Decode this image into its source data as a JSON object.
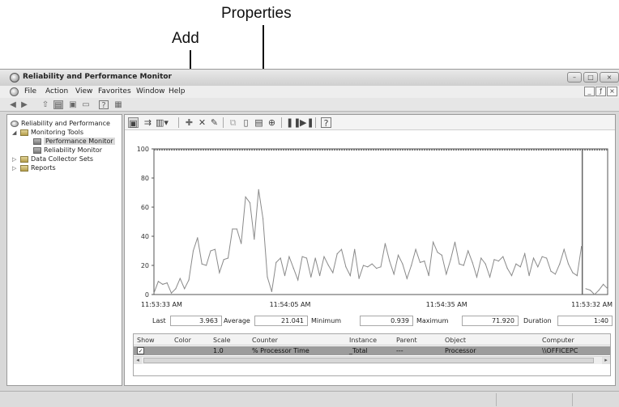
{
  "callouts": {
    "properties": "Properties",
    "add": "Add"
  },
  "window": {
    "title": "Reliability and Performance Monitor",
    "controls": {
      "minimize": "–",
      "maximize": "□",
      "close": "×"
    }
  },
  "menu": {
    "items": [
      "File",
      "Action",
      "View",
      "Favorites",
      "Window",
      "Help"
    ],
    "mdi": {
      "minimize": "_",
      "restore": "ƒ",
      "close": "×"
    }
  },
  "toolbar": {
    "icons": [
      "back-icon",
      "forward-icon",
      "up-icon",
      "show-hide-tree-icon",
      "properties-icon",
      "export-icon",
      "help-icon",
      "mmc-icon"
    ]
  },
  "tree": {
    "root": "Reliability and Performance",
    "monitoring_tools": "Monitoring Tools",
    "performance_monitor": "Performance Monitor",
    "reliability_monitor": "Reliability Monitor",
    "data_collector_sets": "Data Collector Sets",
    "reports": "Reports"
  },
  "chart_toolbar": {
    "icons": [
      "view-current-activity-icon",
      "view-log-data-icon",
      "change-graph-type-icon",
      "add-counter-icon",
      "delete-counter-icon",
      "highlight-icon",
      "copy-properties-icon",
      "paste-counter-list-icon",
      "properties-icon",
      "zoom-icon",
      "freeze-display-icon",
      "update-data-icon",
      "help-icon"
    ]
  },
  "stats": {
    "last_label": "Last",
    "last_value": "3.963",
    "average_label": "Average",
    "average_value": "21.041",
    "minimum_label": "Minimum",
    "minimum_value": "0.939",
    "maximum_label": "Maximum",
    "maximum_value": "71.920",
    "duration_label": "Duration",
    "duration_value": "1:40"
  },
  "counter_table": {
    "headers": [
      "Show",
      "Color",
      "Scale",
      "Counter",
      "Instance",
      "Parent",
      "Object",
      "Computer"
    ],
    "row": {
      "show": "✓",
      "color": "",
      "scale": "1.0",
      "counter": "% Processor Time",
      "instance": "_Total",
      "parent": "---",
      "object": "Processor",
      "computer": "\\\\OFFICEPC"
    },
    "scroll_left": "◂",
    "scroll_right": "▸"
  },
  "chart_data": {
    "type": "line",
    "ylim": [
      0,
      100
    ],
    "yticks": [
      0,
      20,
      40,
      60,
      80,
      100
    ],
    "xtick_labels": [
      "11:53:33 AM",
      "11:54:05 AM",
      "11:54:35 AM",
      "11:53:32 AM"
    ],
    "current_index": 98,
    "series": [
      {
        "color": "#8a8a8a",
        "values": [
          1,
          9,
          7,
          8,
          1,
          4,
          11,
          4,
          10,
          30,
          39,
          21,
          20,
          30,
          31,
          15,
          24,
          25,
          45,
          45,
          35,
          67,
          63,
          38,
          72,
          52,
          12,
          2,
          22,
          25,
          13,
          26,
          18,
          10,
          26,
          25,
          12,
          25,
          13,
          26,
          20,
          15,
          28,
          31,
          19,
          13,
          31,
          11,
          20,
          19,
          21,
          18,
          19,
          35,
          23,
          14,
          27,
          21,
          11,
          20,
          31,
          22,
          23,
          13,
          36,
          29,
          27,
          14,
          24,
          36,
          21,
          20,
          30,
          22,
          12,
          25,
          21,
          12,
          24,
          23,
          26,
          18,
          13,
          21,
          19,
          28,
          13,
          25,
          19,
          26,
          25,
          16,
          14,
          21,
          31,
          21,
          15,
          13,
          33,
          4,
          3,
          0,
          3,
          7,
          4
        ]
      }
    ]
  }
}
